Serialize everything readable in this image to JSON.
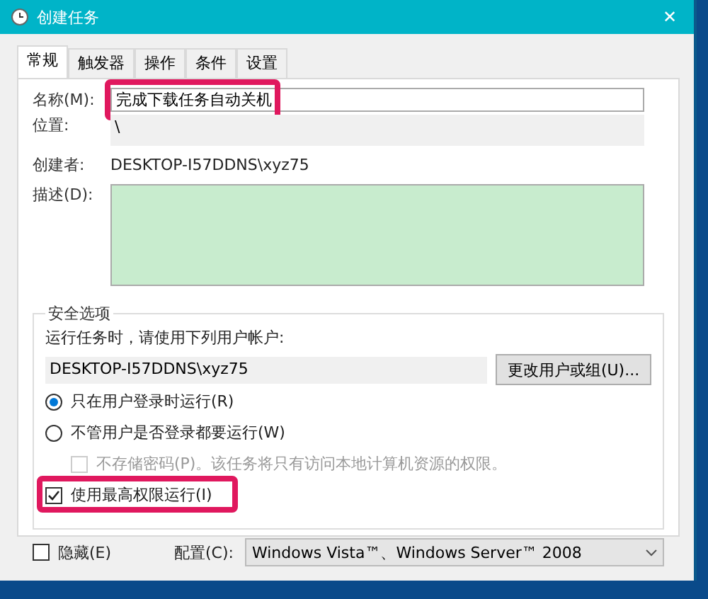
{
  "window": {
    "title": "创建任务",
    "close": "✕"
  },
  "tabs": [
    {
      "label": "常规",
      "selected": true
    },
    {
      "label": "触发器",
      "selected": false
    },
    {
      "label": "操作",
      "selected": false
    },
    {
      "label": "条件",
      "selected": false
    },
    {
      "label": "设置",
      "selected": false
    }
  ],
  "general": {
    "name": {
      "label": "名称(M):",
      "value": "完成下载任务自动关机",
      "highlighted": true
    },
    "location": {
      "label": "位置:",
      "value": "\\"
    },
    "author": {
      "label": "创建者:",
      "value": "DESKTOP-I57DDNS\\xyz75"
    },
    "description": {
      "label": "描述(D):"
    }
  },
  "security": {
    "title": "安全选项",
    "prompt": "运行任务时，请使用下列用户帐户:",
    "account": "DESKTOP-I57DDNS\\xyz75",
    "change_button": "更改用户或组(U)...",
    "options": [
      {
        "kind": "radio",
        "label": "只在用户登录时运行(R)",
        "selected": true,
        "disabled": false,
        "highlighted": false
      },
      {
        "kind": "radio",
        "label": "不管用户是否登录都要运行(W)",
        "selected": false,
        "disabled": false,
        "highlighted": false
      },
      {
        "kind": "checkbox",
        "label": "不存储密码(P)。该任务将只有访问本地计算机资源的权限。",
        "checked": false,
        "disabled": true,
        "highlighted": false
      },
      {
        "kind": "checkbox",
        "label": "使用最高权限运行(I)",
        "checked": true,
        "disabled": false,
        "highlighted": true
      }
    ]
  },
  "footer": {
    "hidden": {
      "label": "隐藏(E)",
      "checked": false
    },
    "config": {
      "label": "配置(C):",
      "value": "Windows Vista™、Windows Server™ 2008"
    }
  }
}
